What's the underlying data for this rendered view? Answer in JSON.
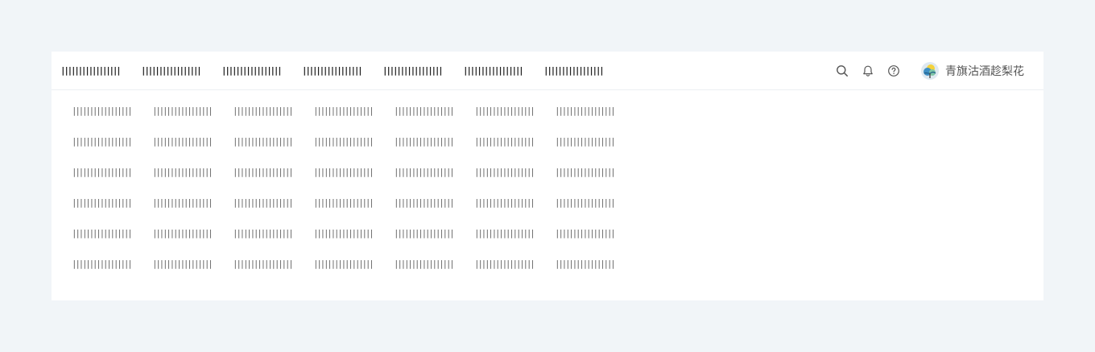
{
  "nav": {
    "items": [
      {
        "label": "|||||||||||||||||"
      },
      {
        "label": "|||||||||||||||||"
      },
      {
        "label": "|||||||||||||||||"
      },
      {
        "label": "|||||||||||||||||"
      },
      {
        "label": "|||||||||||||||||"
      },
      {
        "label": "|||||||||||||||||"
      },
      {
        "label": "|||||||||||||||||"
      }
    ]
  },
  "header": {
    "icons": [
      "search-icon",
      "bell-icon",
      "help-icon"
    ],
    "user": {
      "name": "青旗沽酒趁梨花",
      "avatar_icon": "avatar-image"
    }
  },
  "grid": {
    "rows": [
      {
        "cells": [
          "|||||||||||||||||",
          "|||||||||||||||||",
          "|||||||||||||||||",
          "|||||||||||||||||",
          "|||||||||||||||||",
          "|||||||||||||||||",
          "|||||||||||||||||"
        ]
      },
      {
        "cells": [
          "|||||||||||||||||",
          "|||||||||||||||||",
          "|||||||||||||||||",
          "|||||||||||||||||",
          "|||||||||||||||||",
          "|||||||||||||||||",
          "|||||||||||||||||"
        ]
      },
      {
        "cells": [
          "|||||||||||||||||",
          "|||||||||||||||||",
          "|||||||||||||||||",
          "|||||||||||||||||",
          "|||||||||||||||||",
          "|||||||||||||||||",
          "|||||||||||||||||"
        ]
      },
      {
        "cells": [
          "|||||||||||||||||",
          "|||||||||||||||||",
          "|||||||||||||||||",
          "|||||||||||||||||",
          "|||||||||||||||||",
          "|||||||||||||||||",
          "|||||||||||||||||"
        ]
      },
      {
        "cells": [
          "|||||||||||||||||",
          "|||||||||||||||||",
          "|||||||||||||||||",
          "|||||||||||||||||",
          "|||||||||||||||||",
          "|||||||||||||||||",
          "|||||||||||||||||"
        ]
      },
      {
        "cells": [
          "|||||||||||||||||",
          "|||||||||||||||||",
          "|||||||||||||||||",
          "|||||||||||||||||",
          "|||||||||||||||||",
          "|||||||||||||||||",
          "|||||||||||||||||"
        ]
      }
    ]
  },
  "colors": {
    "page_background": "#f1f5f8",
    "panel_background": "#ffffff",
    "nav_text": "#222222",
    "cell_text": "#666666",
    "icon": "#555555"
  }
}
